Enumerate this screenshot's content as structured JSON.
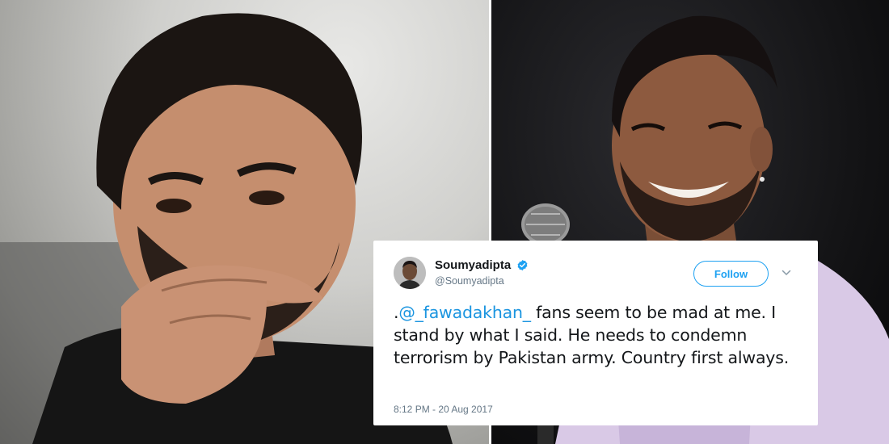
{
  "tweet": {
    "display_name": "Soumyadipta",
    "handle": "@Soumyadipta",
    "follow_label": "Follow",
    "text_lead": ".",
    "mention": "@_fawadakhan_",
    "text_rest": " fans seem to be mad at me. I stand by what I said. He needs to condemn terrorism by Pakistan army. Country first always.",
    "timestamp": "8:12 PM - 20 Aug 2017",
    "icons": {
      "verified": "verified-badge-icon",
      "menu": "chevron-down-icon"
    },
    "colors": {
      "accent": "#1da1f2",
      "mention": "#1b95e0",
      "text": "#14171a",
      "muted": "#657786"
    }
  }
}
